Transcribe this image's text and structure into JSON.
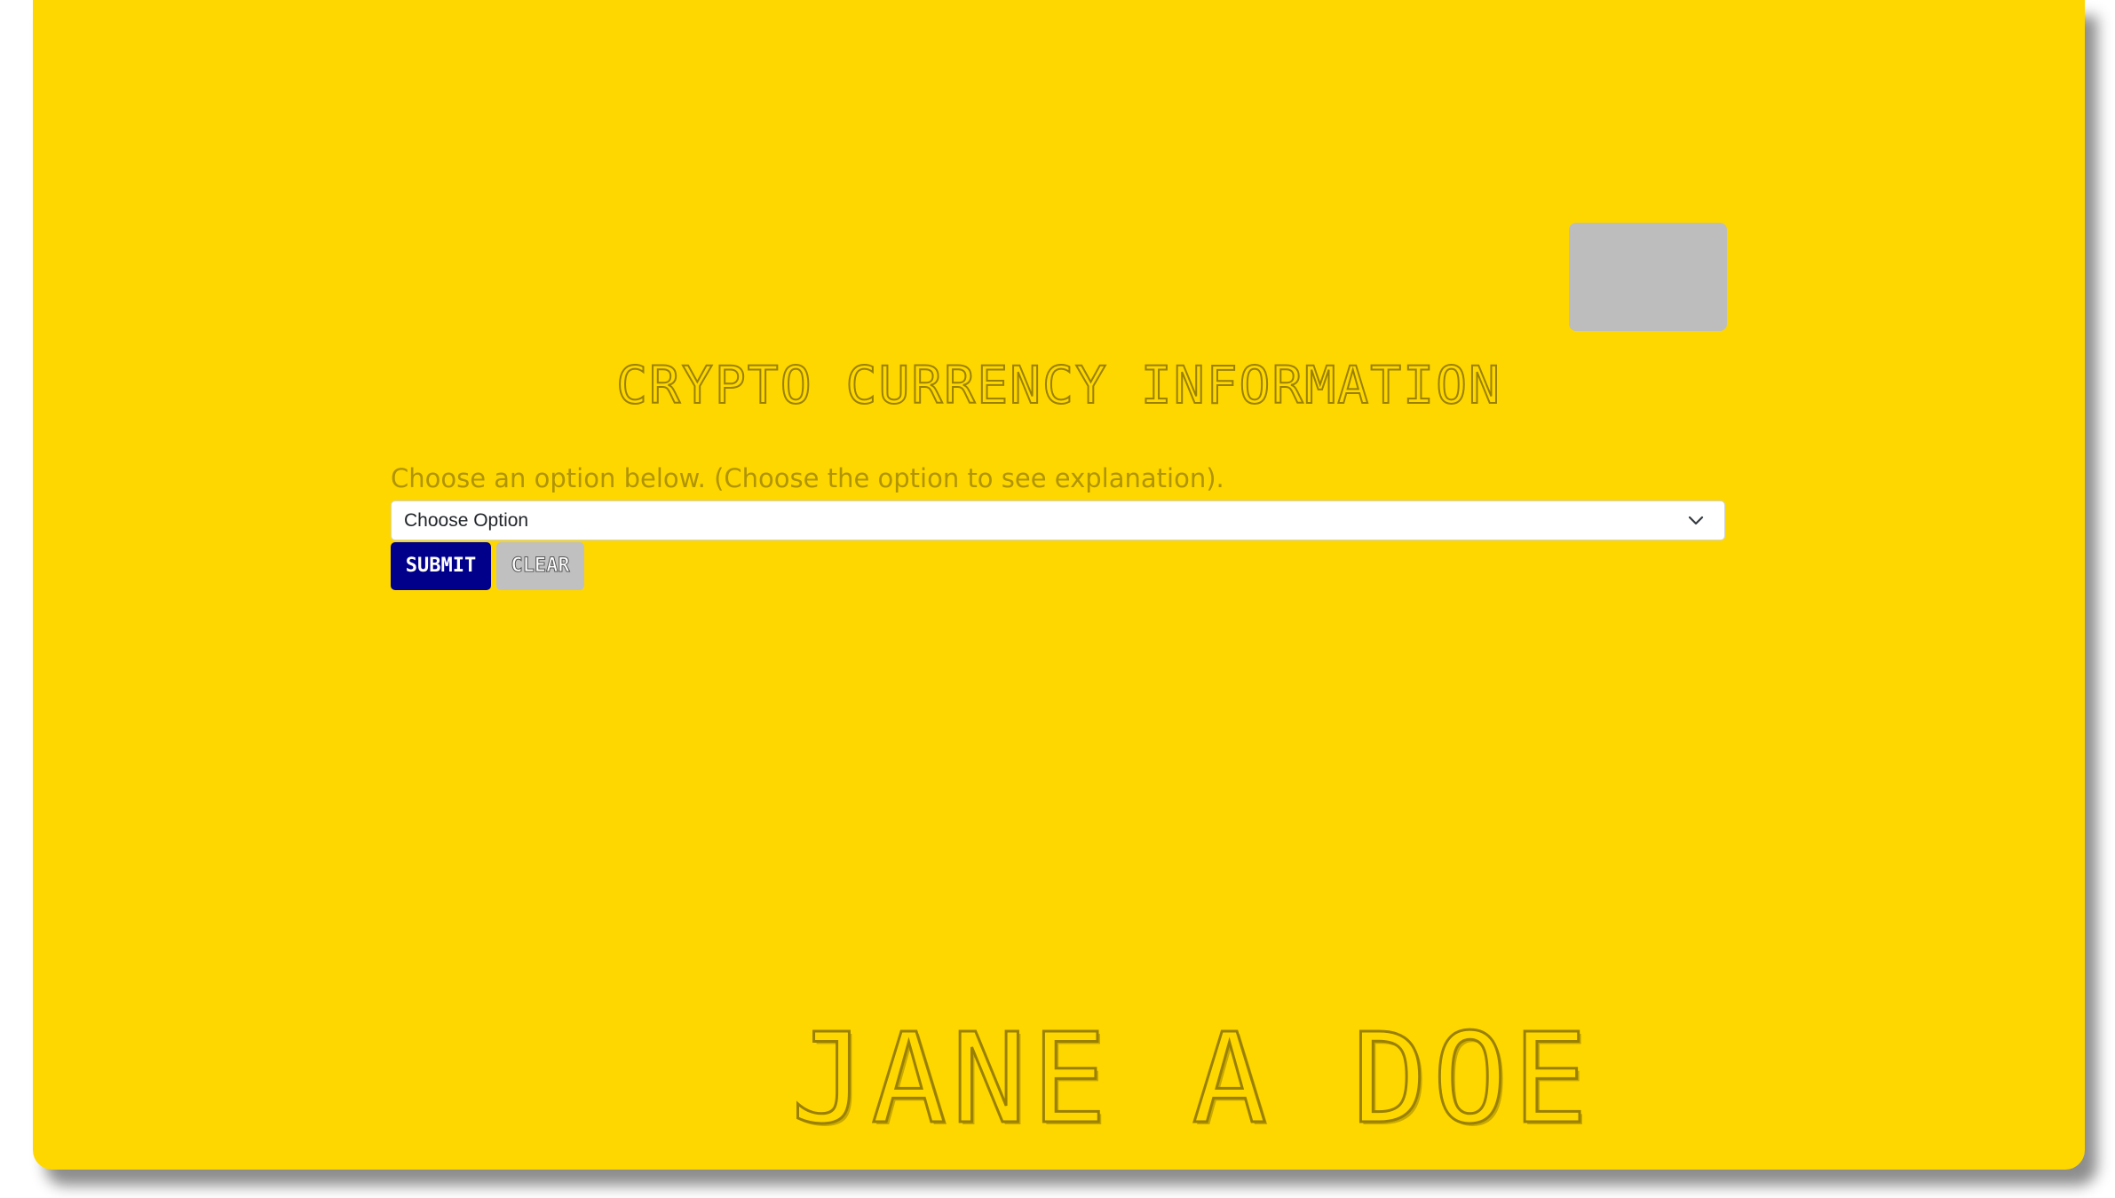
{
  "page": {
    "title": "CRYPTO CURRENCY INFORMATION",
    "prompt": "Choose an option below. (Choose the option to see explanation).",
    "footer_name": "JANE A DOE"
  },
  "form": {
    "select_value": "Choose Option",
    "submit_label": "SUBMIT",
    "clear_label": "CLEAR"
  },
  "icons": {
    "dropdown": "chevron-down-icon"
  },
  "colors": {
    "background": "#FFD700",
    "submit": "#00008B",
    "clear": "#C0C0C0",
    "placeholder_box": "#BDBDBD"
  }
}
